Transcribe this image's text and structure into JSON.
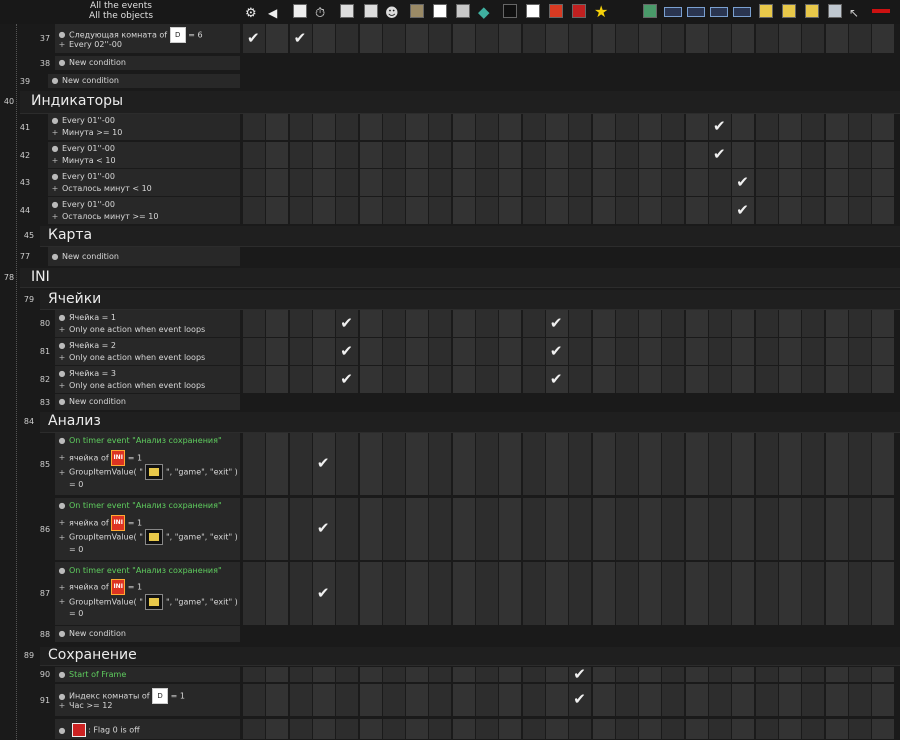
{
  "header": {
    "title_line1": "All the events",
    "title_line2": "All the objects",
    "object_icons": [
      {
        "name": "special-conditions-icon",
        "color": "#eeeeee"
      },
      {
        "name": "sound-icon",
        "color": "#eeeeee"
      },
      {
        "name": "storyboard-icon",
        "color": "#eeeeee"
      },
      {
        "name": "timer-icon",
        "color": "#eeeeee"
      },
      {
        "name": "create-objects-icon",
        "color": "#dddddd"
      },
      {
        "name": "keyboard-mouse-icon",
        "color": "#dddddd"
      },
      {
        "name": "player-icon",
        "color": "#dddddd"
      },
      {
        "name": "background-object-icon",
        "color": "#9a8a66"
      },
      {
        "name": "frame-object-icon",
        "color": "#ffffff"
      },
      {
        "name": "gauge-object-icon",
        "color": "#c8c8c8"
      },
      {
        "name": "diamond-object-icon",
        "color": "#3fb0a0"
      },
      {
        "name": "console-object-icon",
        "color": "#101010"
      },
      {
        "name": "blank-object-icon",
        "color": "#ffffff"
      },
      {
        "name": "ini-object-icon",
        "color": "#d93a22"
      },
      {
        "name": "floppy-object-icon",
        "color": "#c02020"
      },
      {
        "name": "star-object-icon",
        "color": "#f5d10a"
      },
      {
        "name": "picture-object-icon",
        "color": "#4a9a6a"
      },
      {
        "name": "counter-object-1-icon",
        "color": "#7aa0d0"
      },
      {
        "name": "counter-object-2-icon",
        "color": "#7aa0d0"
      },
      {
        "name": "counter-object-3-icon",
        "color": "#7aa0d0"
      },
      {
        "name": "counter-object-4-icon",
        "color": "#7aa0d0"
      },
      {
        "name": "directory-object-1-icon",
        "color": "#e8c84a"
      },
      {
        "name": "directory-object-2-icon",
        "color": "#e8c84a"
      },
      {
        "name": "directory-object-3-icon",
        "color": "#e8c84a"
      },
      {
        "name": "window-object-icon",
        "color": "#c0c8d0"
      },
      {
        "name": "cursor-object-icon",
        "color": "#cccccc"
      },
      {
        "name": "red-bar-object-icon",
        "color": "#cc1111"
      }
    ]
  },
  "events": [
    {
      "num": "37",
      "kind": "event",
      "lines": [
        {
          "b": "●",
          "t": "Следующая комната of",
          "icon": "frame",
          "t2": "= 6"
        },
        {
          "b": "+",
          "t": "Every 02''-00"
        }
      ],
      "checks": [
        0,
        2
      ]
    },
    {
      "num": "38",
      "kind": "newcond",
      "lines": [
        {
          "b": "●",
          "t": "New condition"
        }
      ]
    },
    {
      "num": "39",
      "kind": "newcond",
      "lines": [
        {
          "b": "●",
          "t": "New condition"
        }
      ]
    },
    {
      "num": "40",
      "kind": "group",
      "title": "Индикаторы"
    },
    {
      "num": "41",
      "kind": "event",
      "lines": [
        {
          "b": "●",
          "t": "Every 01''-00"
        },
        {
          "b": "+",
          "t": "Минута >= 10"
        }
      ],
      "checks": [
        20
      ]
    },
    {
      "num": "42",
      "kind": "event",
      "lines": [
        {
          "b": "●",
          "t": "Every 01''-00"
        },
        {
          "b": "+",
          "t": "Минута < 10"
        }
      ],
      "checks": [
        20
      ]
    },
    {
      "num": "43",
      "kind": "event",
      "lines": [
        {
          "b": "●",
          "t": "Every 01''-00"
        },
        {
          "b": "+",
          "t": "Осталось минут < 10"
        }
      ],
      "checks": [
        21
      ]
    },
    {
      "num": "44",
      "kind": "event",
      "lines": [
        {
          "b": "●",
          "t": "Every 01''-00"
        },
        {
          "b": "+",
          "t": "Осталось минут >= 10"
        }
      ],
      "checks": [
        21
      ]
    },
    {
      "num": "45",
      "kind": "group",
      "title": "Карта"
    },
    {
      "num": "77",
      "kind": "newcond",
      "lines": [
        {
          "b": "●",
          "t": "New condition"
        }
      ]
    },
    {
      "num": "78",
      "kind": "group",
      "title": "INI"
    },
    {
      "num": "79",
      "kind": "group",
      "title": "Ячейки"
    },
    {
      "num": "80",
      "kind": "event",
      "lines": [
        {
          "b": "●",
          "t": "Ячейка = 1"
        },
        {
          "b": "+",
          "t": "Only one action when event loops"
        }
      ],
      "checks": [
        4,
        13
      ]
    },
    {
      "num": "81",
      "kind": "event",
      "lines": [
        {
          "b": "●",
          "t": "Ячейка = 2"
        },
        {
          "b": "+",
          "t": "Only one action when event loops"
        }
      ],
      "checks": [
        4,
        13
      ]
    },
    {
      "num": "82",
      "kind": "event",
      "lines": [
        {
          "b": "●",
          "t": "Ячейка = 3"
        },
        {
          "b": "+",
          "t": "Only one action when event loops"
        }
      ],
      "checks": [
        4,
        13
      ]
    },
    {
      "num": "83",
      "kind": "newcond",
      "lines": [
        {
          "b": "●",
          "t": "New condition"
        }
      ]
    },
    {
      "num": "84",
      "kind": "group",
      "title": "Анализ"
    },
    {
      "num": "85",
      "kind": "event",
      "lines": [
        {
          "b": "●",
          "t": "On timer event \"Анализ сохранения\"",
          "green": true
        },
        {
          "b": "+",
          "t": "ячейка of",
          "icon": "ini",
          "t2": "= 1"
        },
        {
          "b": "+",
          "t": "GroupItemValue( \"",
          "icon": "dir",
          "t2": "\", \"game\", \"exit\" )"
        },
        {
          "b": "",
          "t": "= 0"
        }
      ],
      "checks": [
        3
      ]
    },
    {
      "num": "86",
      "kind": "event",
      "lines": [
        {
          "b": "●",
          "t": "On timer event \"Анализ сохранения\"",
          "green": true
        },
        {
          "b": "+",
          "t": "ячейка of",
          "icon": "ini",
          "t2": "= 1"
        },
        {
          "b": "+",
          "t": "GroupItemValue( \"",
          "icon": "dir",
          "t2": "\", \"game\", \"exit\" )"
        },
        {
          "b": "",
          "t": "= 0"
        }
      ],
      "checks": [
        3
      ]
    },
    {
      "num": "87",
      "kind": "event",
      "lines": [
        {
          "b": "●",
          "t": "On timer event \"Анализ сохранения\"",
          "green": true
        },
        {
          "b": "+",
          "t": "ячейка of",
          "icon": "ini",
          "t2": "= 1"
        },
        {
          "b": "+",
          "t": "GroupItemValue( \"",
          "icon": "dir",
          "t2": "\", \"game\", \"exit\" )"
        },
        {
          "b": "",
          "t": "= 0"
        }
      ],
      "checks": [
        3
      ]
    },
    {
      "num": "88",
      "kind": "newcond",
      "lines": [
        {
          "b": "●",
          "t": "New condition"
        }
      ]
    },
    {
      "num": "89",
      "kind": "group",
      "title": "Сохранение"
    },
    {
      "num": "90",
      "kind": "event",
      "lines": [
        {
          "b": "●",
          "t": "Start of Frame",
          "green": true
        }
      ],
      "checks": [
        14
      ]
    },
    {
      "num": "91",
      "kind": "event",
      "lines": [
        {
          "b": "●",
          "t": "Индекс комнаты of",
          "icon": "frame",
          "t2": "= 1"
        },
        {
          "b": "+",
          "t": "Час >= 12"
        }
      ],
      "checks": [
        14
      ]
    },
    {
      "num": "",
      "kind": "event",
      "lines": [
        {
          "b": "●",
          "t": "",
          "icon": "disk",
          "t2": ": Flag 0 is off"
        }
      ],
      "checks": []
    }
  ]
}
